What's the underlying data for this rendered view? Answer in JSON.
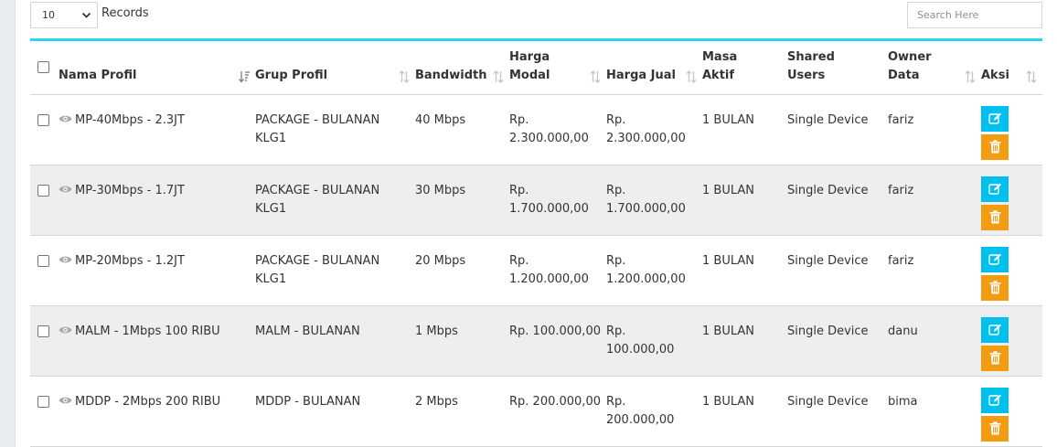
{
  "toolbar": {
    "page_size": "10",
    "records_label": "Records",
    "search_placeholder": "Search Here"
  },
  "table": {
    "headers": {
      "nama_profil": "Nama Profil",
      "grup_profil": "Grup Profil",
      "bandwidth": "Bandwidth",
      "harga_modal": "Harga Modal",
      "harga_jual": "Harga Jual",
      "masa_aktif": "Masa Aktif",
      "shared_users": "Shared Users",
      "owner_data": "Owner Data",
      "aksi": "Aksi"
    },
    "rows": [
      {
        "nama": "MP-40Mbps - 2.3JT",
        "grup": "PACKAGE - BULANAN KLG1",
        "bandwidth": "40 Mbps",
        "modal": "Rp. 2.300.000,00",
        "jual": "Rp. 2.300.000,00",
        "masa": "1 BULAN",
        "shared": "Single Device",
        "owner": "fariz"
      },
      {
        "nama": "MP-30Mbps - 1.7JT",
        "grup": "PACKAGE - BULANAN KLG1",
        "bandwidth": "30 Mbps",
        "modal": "Rp. 1.700.000,00",
        "jual": "Rp. 1.700.000,00",
        "masa": "1 BULAN",
        "shared": "Single Device",
        "owner": "fariz"
      },
      {
        "nama": "MP-20Mbps - 1.2JT",
        "grup": "PACKAGE - BULANAN KLG1",
        "bandwidth": "20 Mbps",
        "modal": "Rp. 1.200.000,00",
        "jual": "Rp. 1.200.000,00",
        "masa": "1 BULAN",
        "shared": "Single Device",
        "owner": "fariz"
      },
      {
        "nama": "MALM - 1Mbps 100 RIBU",
        "grup": "MALM - BULANAN",
        "bandwidth": "1 Mbps",
        "modal": "Rp. 100.000,00",
        "jual": "Rp. 100.000,00",
        "masa": "1 BULAN",
        "shared": "Single Device",
        "owner": "danu"
      },
      {
        "nama": "MDDP - 2Mbps 200 RIBU",
        "grup": "MDDP - BULANAN",
        "bandwidth": "2 Mbps",
        "modal": "Rp. 200.000,00",
        "jual": "Rp. 200.000,00",
        "masa": "1 BULAN",
        "shared": "Single Device",
        "owner": "bima"
      }
    ]
  },
  "icons": {
    "view": "eye-icon",
    "edit": "edit-icon",
    "delete": "trash-icon",
    "sort": "sort-icon"
  },
  "colors": {
    "accent_line": "#27d6f2",
    "edit_button": "#00c0ef",
    "delete_button": "#f39c12",
    "row_alt": "#eeeeee"
  }
}
